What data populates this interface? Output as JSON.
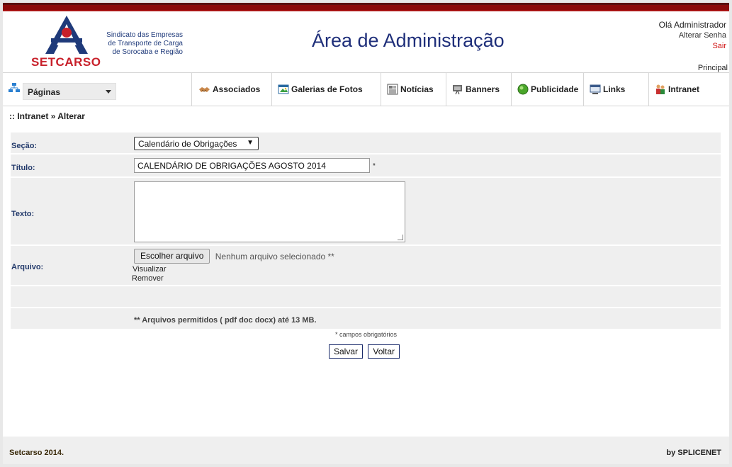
{
  "header": {
    "brand": "SETCARSO",
    "tagline": [
      "Sindicato das Empresas",
      "de Transporte de Carga",
      "de Sorocaba e Região"
    ],
    "title": "Área de Administração",
    "greeting": "Olá Administrador",
    "change_password": "Alterar Senha",
    "logout": "Sair",
    "home": "Principal"
  },
  "nav": {
    "pages_label": "Páginas",
    "items": [
      {
        "label": "Associados",
        "icon": "handshake-icon"
      },
      {
        "label": "Galerias de Fotos",
        "icon": "gallery-icon"
      },
      {
        "label": "Notícias",
        "icon": "newspaper-icon"
      },
      {
        "label": "Banners",
        "icon": "banner-icon"
      },
      {
        "label": "Publicidade",
        "icon": "green-circle-icon"
      },
      {
        "label": "Links",
        "icon": "links-icon"
      },
      {
        "label": "Intranet",
        "icon": "users-icon"
      }
    ]
  },
  "breadcrumb": ":: Intranet » Alterar",
  "form": {
    "section_label": "Seção:",
    "section_value": "Calendário de Obrigações",
    "title_label": "Título:",
    "title_value": "CALENDÁRIO DE OBRIGAÇÕES AGOSTO 2014",
    "required_mark": "*",
    "text_label": "Texto:",
    "text_value": "",
    "file_label": "Arquivo:",
    "file_button": "Escolher arquivo",
    "file_status": "Nenhum arquivo selecionado **",
    "view_link": "Visualizar",
    "remove_link": "Remover",
    "allowed_note": "** Arquivos permitidos ( pdf doc docx) até 13 MB."
  },
  "required_note": "* campos obrigatórios",
  "buttons": {
    "save": "Salvar",
    "back": "Voltar"
  },
  "footer": {
    "left": "Setcarso 2014.",
    "right": "by SPLICENET"
  },
  "colors": {
    "top_bar": "#8b0a0a",
    "title": "#1f2f7a",
    "brand_red": "#c8202a",
    "logout": "#d01010"
  }
}
